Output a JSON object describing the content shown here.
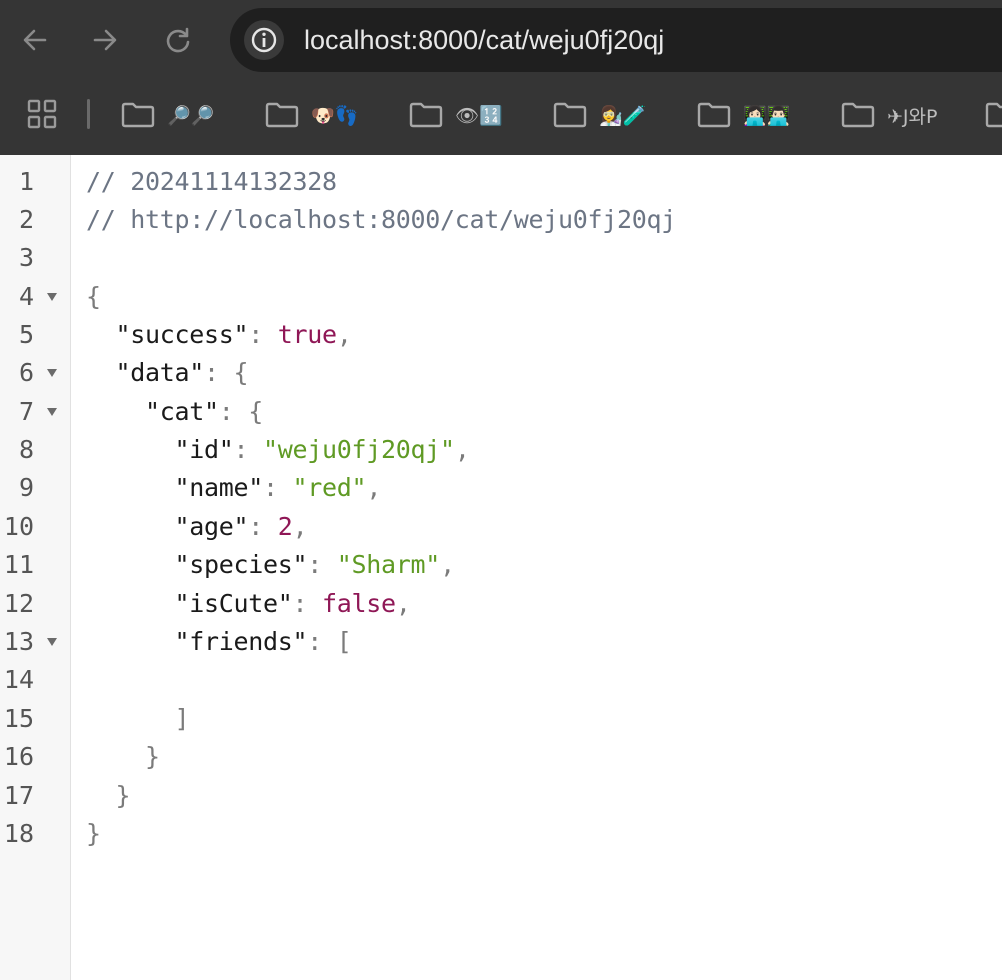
{
  "browser": {
    "url": "localhost:8000/cat/weju0fj20qj",
    "bookmarks": [
      {
        "label": "🔎🔎"
      },
      {
        "label": "🐶👣"
      },
      {
        "label": "👁🔢"
      },
      {
        "label": "👩‍🔬🧪"
      },
      {
        "label": "👩🏻‍💻👨🏻‍💻"
      },
      {
        "label": "✈J와P"
      }
    ]
  },
  "viewer": {
    "line_numbers": [
      "1",
      "2",
      "3",
      "4",
      "5",
      "6",
      "7",
      "8",
      "9",
      "10",
      "11",
      "12",
      "13",
      "14",
      "15",
      "16",
      "17",
      "18"
    ],
    "comment_timestamp": "// 20241114132328",
    "comment_url": "// http://localhost:8000/cat/weju0fj20qj",
    "json": {
      "success_key": "\"success\"",
      "success_value": "true",
      "data_key": "\"data\"",
      "cat_key": "\"cat\"",
      "id_key": "\"id\"",
      "id_value": "\"weju0fj20qj\"",
      "name_key": "\"name\"",
      "name_value": "\"red\"",
      "age_key": "\"age\"",
      "age_value": "2",
      "species_key": "\"species\"",
      "species_value": "\"Sharm\"",
      "isCute_key": "\"isCute\"",
      "isCute_value": "false",
      "friends_key": "\"friends\""
    }
  }
}
